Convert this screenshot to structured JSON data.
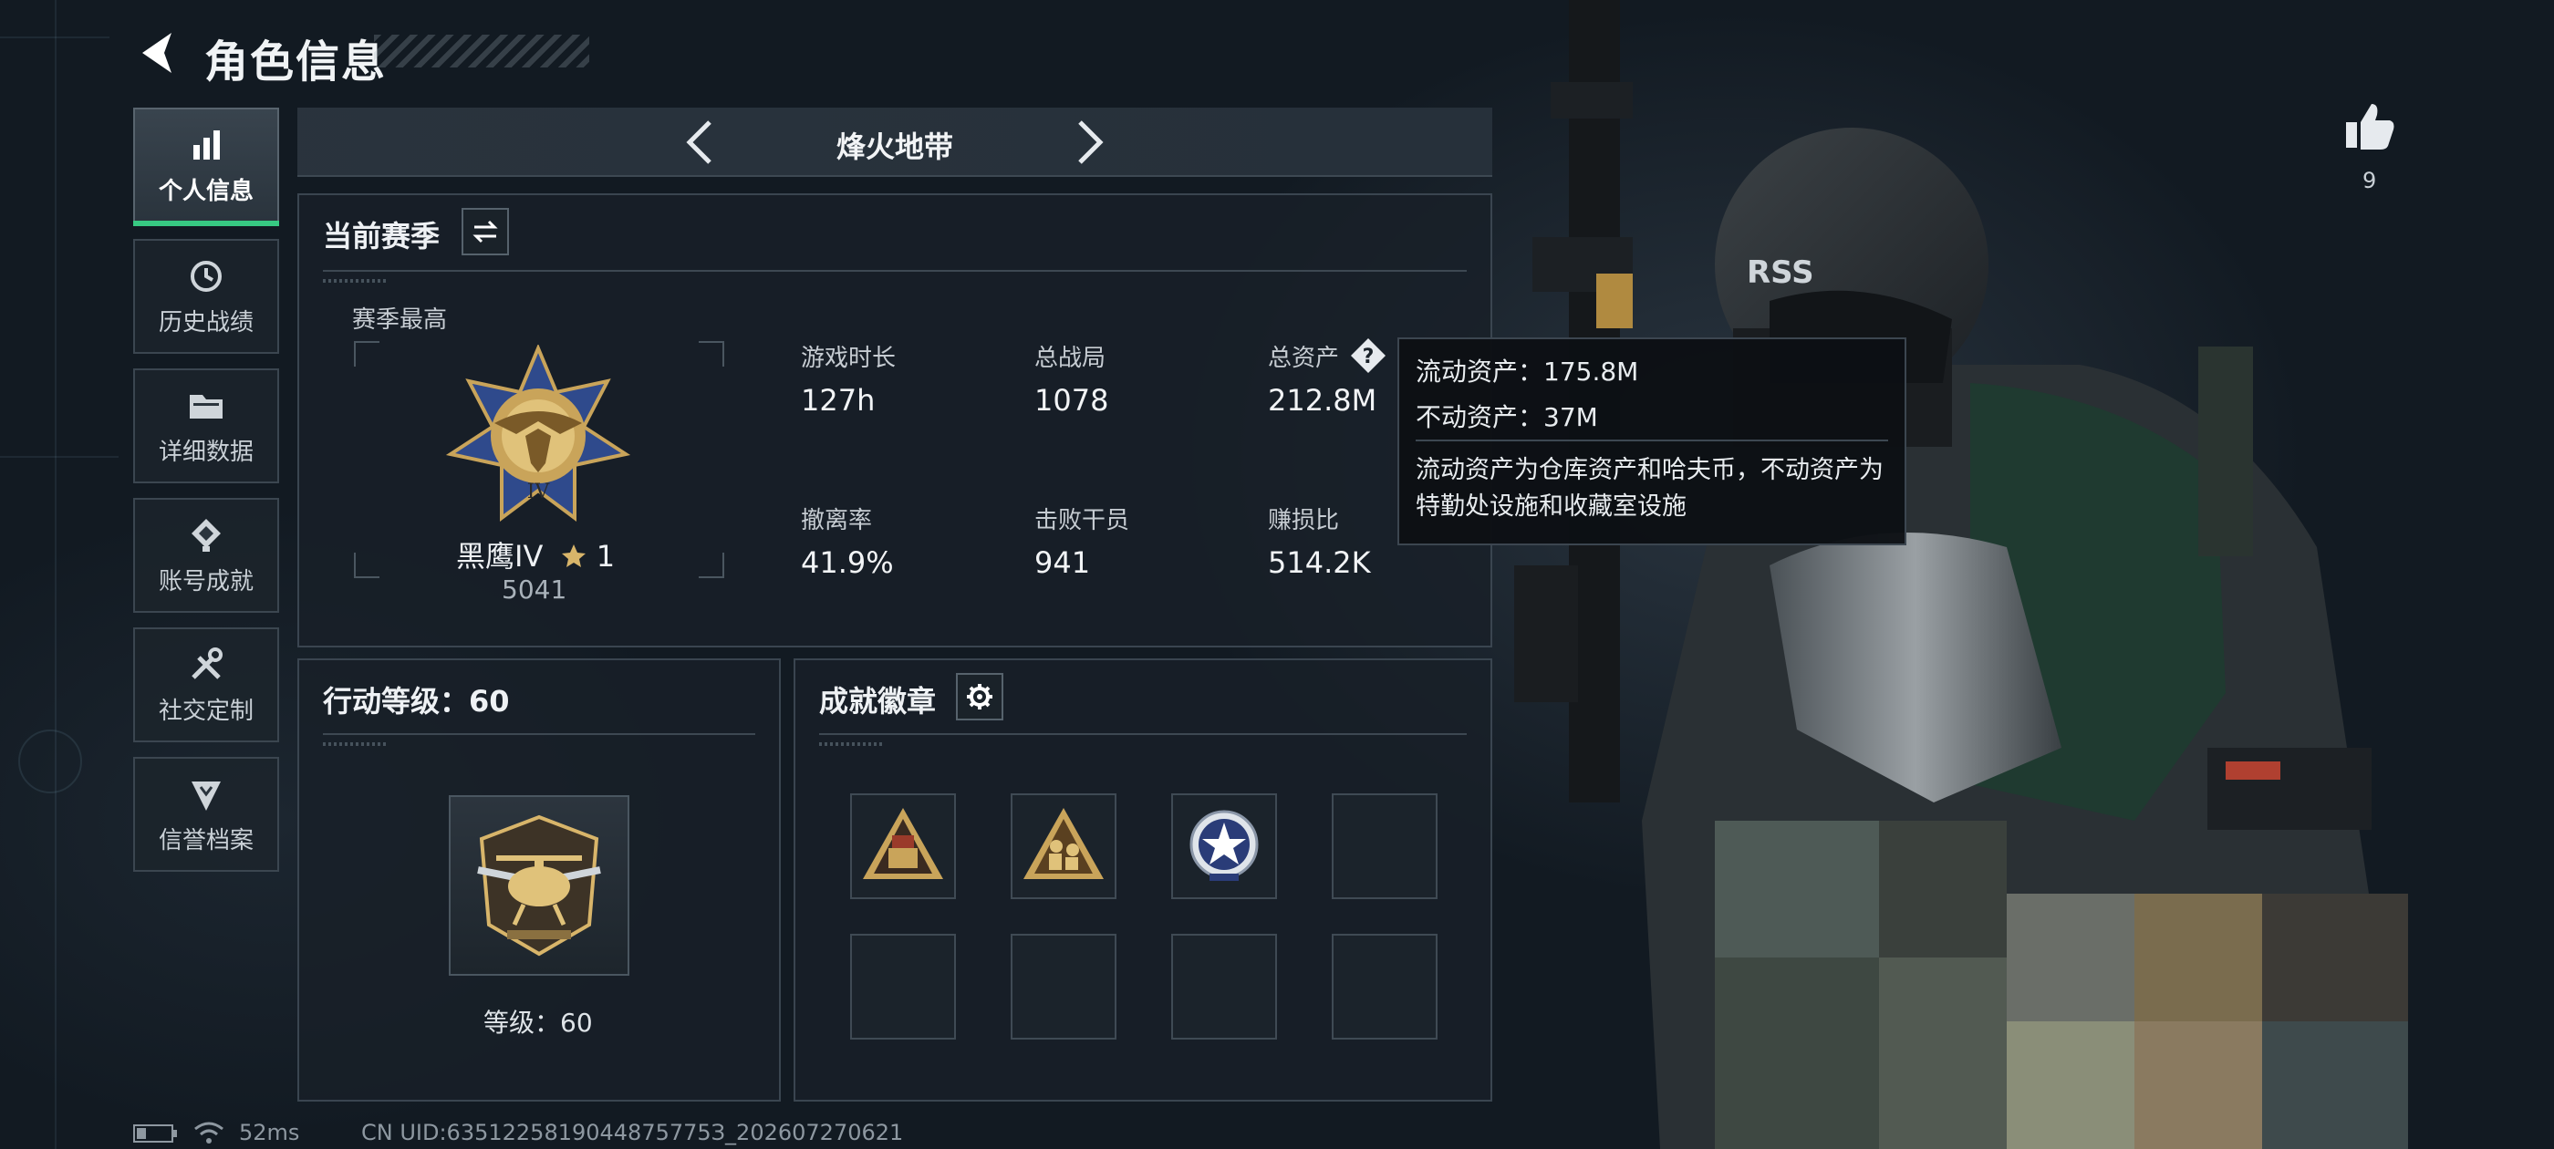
{
  "header": {
    "title": "角色信息"
  },
  "sidebar": {
    "items": [
      {
        "label": "个人信息",
        "icon": "bar-chart-icon",
        "active": true
      },
      {
        "label": "历史战绩",
        "icon": "history-icon",
        "active": false
      },
      {
        "label": "详细数据",
        "icon": "folder-icon",
        "active": false
      },
      {
        "label": "账号成就",
        "icon": "achievement-icon",
        "active": false
      },
      {
        "label": "社交定制",
        "icon": "tools-icon",
        "active": false
      },
      {
        "label": "信誉档案",
        "icon": "shield-icon",
        "active": false
      }
    ]
  },
  "mode": {
    "name": "烽火地带"
  },
  "season": {
    "title": "当前赛季",
    "best_label": "赛季最高",
    "rank_name": "黑鹰IV",
    "rank_stars": "1",
    "rank_score": "5041",
    "stats": [
      {
        "label": "游戏时长",
        "value": "127h"
      },
      {
        "label": "总战局",
        "value": "1078"
      },
      {
        "label": "总资产",
        "value": "212.8M"
      },
      {
        "label": "撤离率",
        "value": "41.9%"
      },
      {
        "label": "击败干员",
        "value": "941"
      },
      {
        "label": "赚损比",
        "value": "514.2K"
      }
    ]
  },
  "tooltip": {
    "liquid": "流动资产：175.8M",
    "fixed": "不动资产：37M",
    "description": "流动资产为仓库资产和哈夫币，不动资产为特勤处设施和收藏室设施"
  },
  "action_level": {
    "title": "行动等级：60",
    "level_text": "等级：60"
  },
  "badges": {
    "title": "成就徽章"
  },
  "like": {
    "count": "9"
  },
  "status_bar": {
    "ping": "52ms",
    "uid": "CN UID:6351225819044875775З_202607270621"
  },
  "colors": {
    "accent_green": "#37c982",
    "gold": "#d8b56a"
  }
}
